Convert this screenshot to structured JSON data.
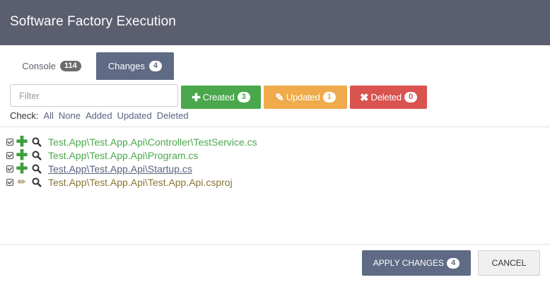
{
  "header": {
    "title": "Software Factory Execution"
  },
  "tabs": [
    {
      "label": "Console",
      "count": "114",
      "active": false
    },
    {
      "label": "Changes",
      "count": "4",
      "active": true
    }
  ],
  "filter": {
    "placeholder": "Filter",
    "value": ""
  },
  "filter_buttons": {
    "created": {
      "label": "Created",
      "count": "3",
      "icon": "plus-icon",
      "color": "#4aa84c"
    },
    "updated": {
      "label": "Updated",
      "count": "1",
      "icon": "pencil-icon",
      "color": "#efab4b"
    },
    "deleted": {
      "label": "Deleted",
      "count": "0",
      "icon": "x-icon",
      "color": "#d9534f"
    }
  },
  "check": {
    "label": "Check:",
    "options": [
      "All",
      "None",
      "Added",
      "Updated",
      "Deleted"
    ]
  },
  "files": [
    {
      "path": "Test.App\\Test.App.Api\\Controller\\TestService.cs",
      "status": "added",
      "checked": true
    },
    {
      "path": "Test.App\\Test.App.Api\\Program.cs",
      "status": "added",
      "checked": true
    },
    {
      "path": "Test.App\\Test.App.Api\\Startup.cs",
      "status": "added",
      "checked": true
    },
    {
      "path": "Test.App\\Test.App.Api\\Test.App.Api.csproj",
      "status": "updated",
      "checked": true
    }
  ],
  "footer": {
    "apply_label": "APPLY CHANGES",
    "apply_count": "4",
    "cancel_label": "CANCEL"
  },
  "colors": {
    "header": "#5b5e6e",
    "accent": "#5f6a84"
  }
}
